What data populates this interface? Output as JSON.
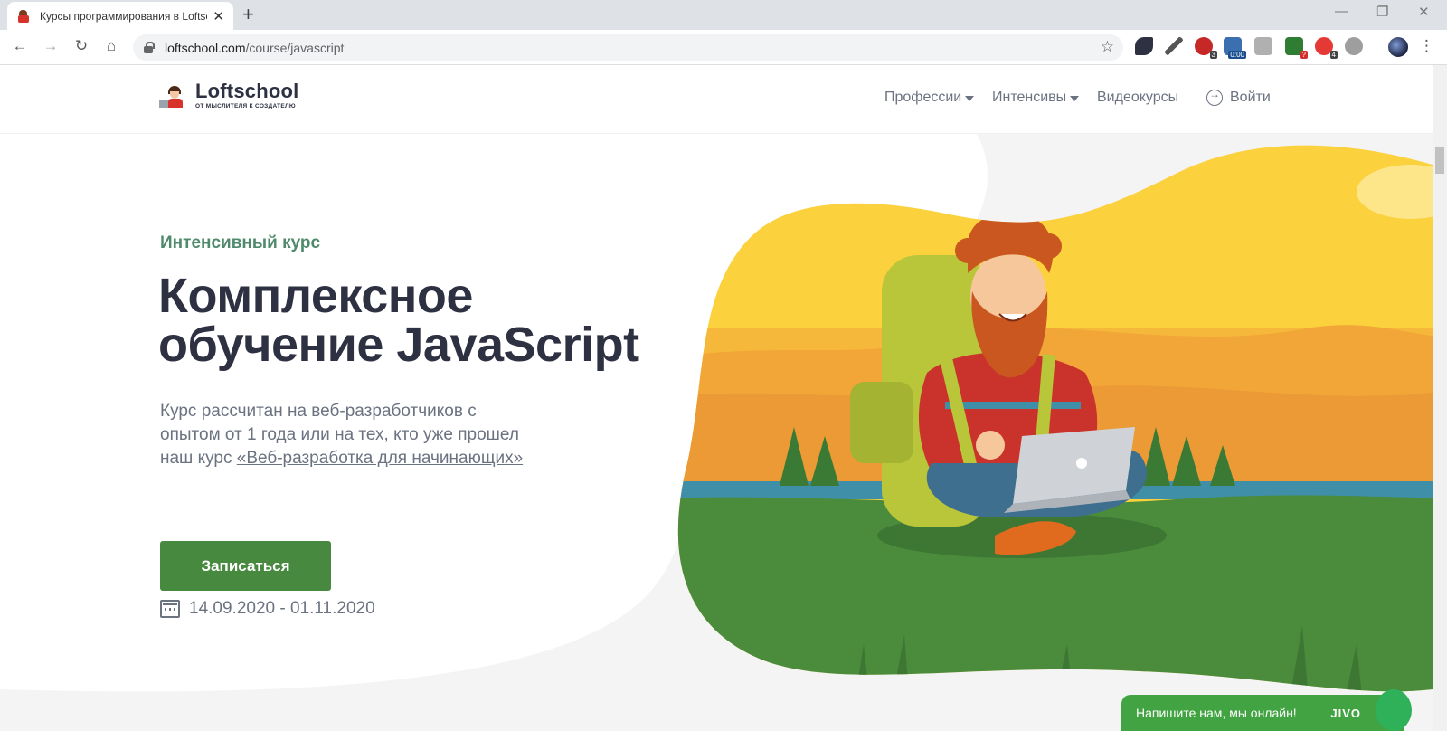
{
  "browser": {
    "tab_title": "Курсы программирования в Loftschool",
    "new_tab": "+",
    "tab_close": "✕",
    "url_host": "loftschool.com",
    "url_path": "/course/javascript",
    "nav_back": "←",
    "nav_forward": "→",
    "nav_reload": "↻",
    "nav_home": "⌂",
    "bookmark_star": "☆",
    "menu": "⋮",
    "win_min": "—",
    "win_restore": "❐",
    "win_close": "✕",
    "extensions": [
      {
        "icon": "leaf-icon",
        "badge": ""
      },
      {
        "icon": "eyedropper-icon",
        "badge": ""
      },
      {
        "icon": "adblock-icon",
        "badge": "3"
      },
      {
        "icon": "share-timer-icon",
        "badge": "0:00"
      },
      {
        "icon": "avatar-ext-icon",
        "badge": ""
      },
      {
        "icon": "screen-ext-icon",
        "badge": "?"
      },
      {
        "icon": "opera-icon",
        "badge": "4"
      },
      {
        "icon": "eye-ext-icon",
        "badge": ""
      }
    ]
  },
  "header": {
    "logo_name": "Loftschool",
    "logo_tagline": "ОТ МЫСЛИТЕЛЯ К СОЗДАТЕЛЮ",
    "nav": {
      "professions": "Профессии",
      "intensives": "Интенсивы",
      "videocourses": "Видеокурсы",
      "login": "Войти"
    }
  },
  "hero": {
    "eyebrow": "Интенсивный курс",
    "title_line1": "Комплексное",
    "title_line2": "обучение JavaScript",
    "desc_text": "Курс рассчитан на веб-разработчиков с опытом от 1 года или на тех, кто уже прошел наш курс ",
    "desc_link": "«Веб-разработка для начинающих»",
    "cta_label": "Записаться",
    "dates": "14.09.2020 - 01.11.2020"
  },
  "chat": {
    "label": "Напишите нам, мы онлайн!",
    "brand": "JIVO"
  },
  "colors": {
    "accent_green": "#47893e",
    "eyebrow_green": "#4f8a6b",
    "title_dark": "#2d3142",
    "sky_yellow": "#f9c93b",
    "grass_green": "#4a8b3c"
  }
}
